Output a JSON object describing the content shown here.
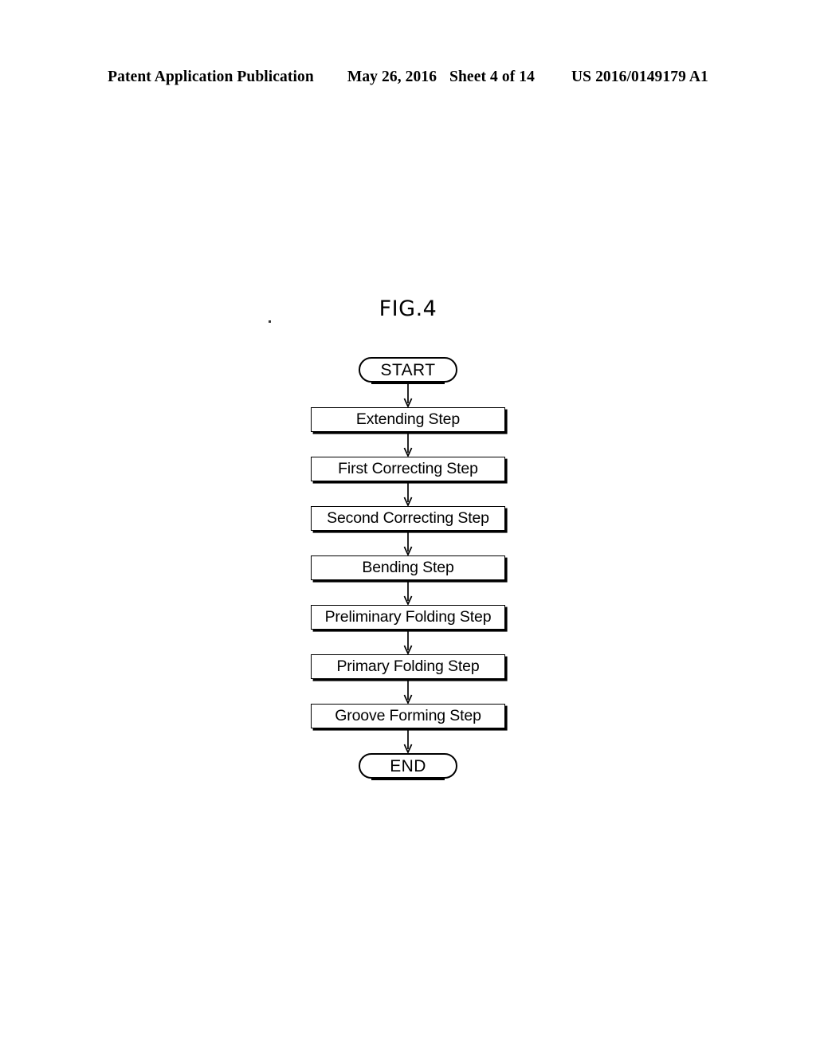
{
  "header": {
    "publication": "Patent Application Publication",
    "date": "May 26, 2016",
    "sheet": "Sheet 4 of 14",
    "number": "US 2016/0149179 A1"
  },
  "figure": {
    "title": "FIG.4"
  },
  "chart_data": {
    "type": "diagram",
    "diagram_type": "flowchart",
    "orientation": "vertical",
    "title": "FIG.4",
    "nodes": [
      {
        "id": "start",
        "shape": "terminator",
        "label": "START"
      },
      {
        "id": "s1",
        "shape": "process",
        "label": "Extending Step"
      },
      {
        "id": "s2",
        "shape": "process",
        "label": "First Correcting Step"
      },
      {
        "id": "s3",
        "shape": "process",
        "label": "Second Correcting Step"
      },
      {
        "id": "s4",
        "shape": "process",
        "label": "Bending Step"
      },
      {
        "id": "s5",
        "shape": "process",
        "label": "Preliminary Folding Step"
      },
      {
        "id": "s6",
        "shape": "process",
        "label": "Primary Folding Step"
      },
      {
        "id": "s7",
        "shape": "process",
        "label": "Groove Forming Step"
      },
      {
        "id": "end",
        "shape": "terminator",
        "label": "END"
      }
    ],
    "edges": [
      {
        "from": "start",
        "to": "s1",
        "style": "arrow"
      },
      {
        "from": "s1",
        "to": "s2",
        "style": "arrow"
      },
      {
        "from": "s2",
        "to": "s3",
        "style": "arrow"
      },
      {
        "from": "s3",
        "to": "s4",
        "style": "arrow"
      },
      {
        "from": "s4",
        "to": "s5",
        "style": "arrow"
      },
      {
        "from": "s5",
        "to": "s6",
        "style": "arrow"
      },
      {
        "from": "s6",
        "to": "s7",
        "style": "arrow"
      },
      {
        "from": "s7",
        "to": "end",
        "style": "arrow"
      }
    ],
    "colors": {
      "ink": "#000000",
      "paper": "#ffffff"
    }
  }
}
